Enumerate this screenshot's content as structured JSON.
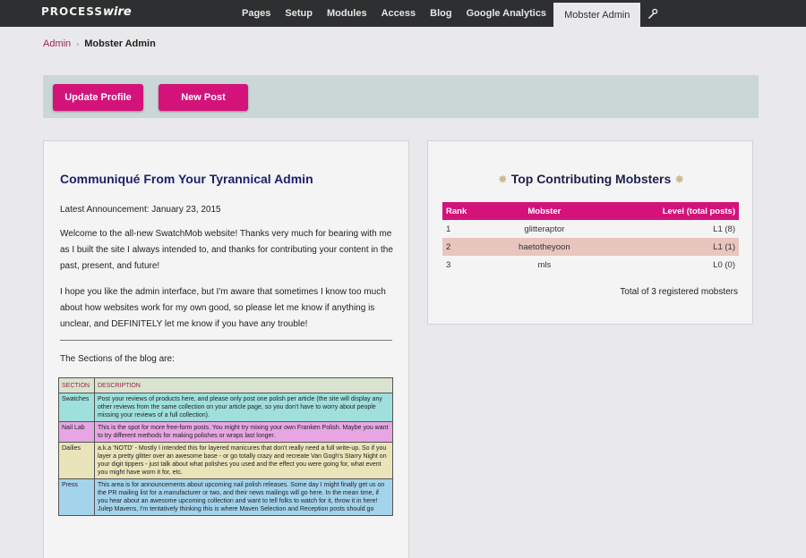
{
  "app": {
    "logo_main": "PROCESS",
    "logo_wire": "wire"
  },
  "nav": {
    "items": [
      "Pages",
      "Setup",
      "Modules",
      "Access",
      "Blog",
      "Google Analytics"
    ],
    "active": "Mobster Admin",
    "tools_icon": "wrench-icon"
  },
  "breadcrumb": {
    "root": "Admin",
    "current": "Mobster Admin"
  },
  "actions": {
    "update_profile": "Update Profile",
    "new_post": "New Post"
  },
  "communique": {
    "title": "Communiqué From Your Tyrannical Admin",
    "announcement": "Latest Announcement: January 23, 2015",
    "para1": "Welcome to the all-new SwatchMob website! Thanks very much for bearing with me as I built the site I always intended to, and thanks for contributing your content in the past, present, and future!",
    "para2": "I hope you like the admin interface, but I'm aware that sometimes I know too much about how websites work for my own good, so please let me know if anything is unclear, and DEFINITELY let me know if you have any trouble!",
    "sections_intro": "The Sections of the blog are:",
    "table_headers": {
      "section": "SECTION",
      "description": "DESCRIPTION"
    },
    "sections": [
      {
        "name": "Swatches",
        "color": "#9fe0dd",
        "desc": "Post your reviews of products here, and please only post one polish per article (the site will display any other reviews from the same collection on your article page, so you don't have to worry about people missing your reviews of a full collection)."
      },
      {
        "name": "Nail Lab",
        "color": "#e7a6e3",
        "desc": "This is the spot for more free-form posts. You might try mixing your own Franken Polish. Maybe you want to try different methods for making polishes or wraps last longer."
      },
      {
        "name": "Dailies",
        "color": "#eae4bb",
        "desc": "a.k.a 'NOTD' - Mostly I intended this for layered manicures that don't really need a full write-up. So if you layer a pretty glitter over an awesome base - or go totally crazy and recreate Van Gogh's Starry Night on your digit tippers - just talk about what polishes you used and the effect you were going for, what event you might have worn it for, etc."
      },
      {
        "name": "Press",
        "color": "#a4d3ec",
        "desc": "This area is for announcements about upcoming nail polish releases. Some day I might finally get us on the PR mailing list for a manufacturer or two, and their news mailings will go here. In the mean time, if you hear about an awesome upcoming collection and want to tell folks to watch for it, throw it in here! Julep Mavens, I'm tentatively thinking this is where Maven Selection and Reception posts should go"
      }
    ]
  },
  "leaderboard": {
    "title": "Top Contributing Mobsters",
    "star_icon": "sparkle-star-icon",
    "headers": {
      "rank": "Rank",
      "mobster": "Mobster",
      "level": "Level (total posts)"
    },
    "rows": [
      {
        "rank": "1",
        "mobster": "glitteraptor",
        "level": "L1 (8)"
      },
      {
        "rank": "2",
        "mobster": "haetotheyoon",
        "level": "L1 (1)"
      },
      {
        "rank": "3",
        "mobster": "mls",
        "level": "L0 (0)"
      }
    ],
    "total": "Total of 3 registered mobsters"
  },
  "colors": {
    "accent": "#d3137a",
    "topbar": "#2e2f30",
    "title_navy": "#1f1f6b",
    "alt_row": "#e8c5bd",
    "actionbar": "#cbd7d6"
  }
}
